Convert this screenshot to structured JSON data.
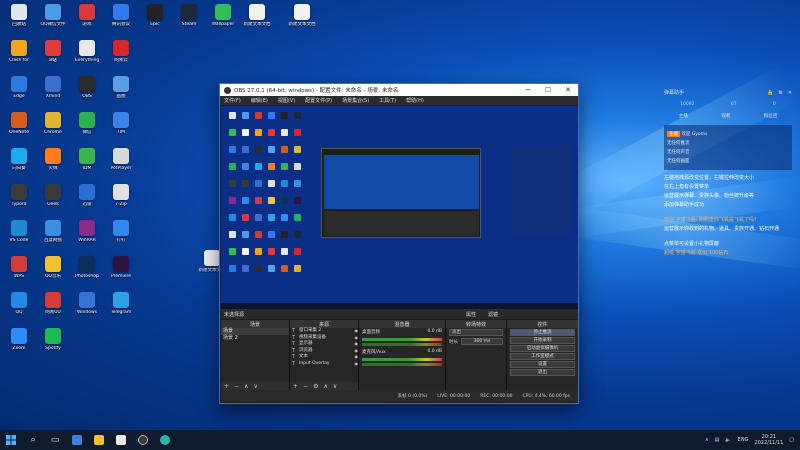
{
  "desktop": {
    "icons": [
      {
        "label": "回收站",
        "color": "#dfe7ef"
      },
      {
        "label": "QQ微信文件",
        "color": "#4a9be8"
      },
      {
        "label": "游戏",
        "color": "#d63a3a"
      },
      {
        "label": "腾讯会议",
        "color": "#2f7af0"
      },
      {
        "label": "Epic",
        "color": "#222222"
      },
      {
        "label": "Steam",
        "color": "#1b2838"
      },
      {
        "label": "Wallpaper",
        "color": "#2fbf5a"
      },
      {
        "label": "新建文本文档",
        "color": "#f2f2f2"
      },
      {
        "label": "Clash for",
        "color": "#f1a41c"
      },
      {
        "label": "B站",
        "color": "#e33b3b"
      },
      {
        "label": "Everything",
        "color": "#e9e9e9"
      },
      {
        "label": "网易云",
        "color": "#d6262a"
      },
      {
        "label": "Edge",
        "color": "#2a7ae0"
      },
      {
        "label": "Xmind",
        "color": "#3a6fcf"
      },
      {
        "label": "OBS",
        "color": "#2b2b2b"
      },
      {
        "label": "画图",
        "color": "#5a9ee3"
      },
      {
        "label": "OneNote",
        "color": "#d45c1e"
      },
      {
        "label": "Chrome",
        "color": "#e3b52e"
      },
      {
        "label": "微信",
        "color": "#2bb24c"
      },
      {
        "label": "TIM",
        "color": "#3b83e6"
      },
      {
        "label": "向日葵",
        "color": "#1eaaf0"
      },
      {
        "label": "火绒",
        "color": "#ff7c1a"
      },
      {
        "label": "IDM",
        "color": "#3cb44b"
      },
      {
        "label": "PotPlayer",
        "color": "#d9d9d9"
      },
      {
        "label": "Typora",
        "color": "#3b3b3b"
      },
      {
        "label": "Geek",
        "color": "#3a3a3a"
      },
      {
        "label": "迅雷",
        "color": "#2a6fd6"
      },
      {
        "label": "7-Zip",
        "color": "#e1e1e1"
      },
      {
        "label": "VS Code",
        "color": "#1f8ad3"
      },
      {
        "label": "百度网盘",
        "color": "#3a8ee6"
      },
      {
        "label": "WinRAR",
        "color": "#8a2c8a"
      },
      {
        "label": "钉钉",
        "color": "#2f88f0"
      },
      {
        "label": "WPS",
        "color": "#d43b3b"
      },
      {
        "label": "QQ音乐",
        "color": "#f2c12e"
      },
      {
        "label": "Photoshop",
        "color": "#0a2f5a"
      },
      {
        "label": "Premiere",
        "color": "#2a1446"
      },
      {
        "label": "QQ",
        "color": "#1e8be6"
      },
      {
        "label": "网易UU",
        "color": "#d63a3a"
      },
      {
        "label": "Windows",
        "color": "#3574d4"
      },
      {
        "label": "Telegram",
        "color": "#2aa3e6"
      },
      {
        "label": "Zoom",
        "color": "#2d8cff"
      },
      {
        "label": "Spotify",
        "color": "#1db954"
      }
    ],
    "loose_file": "新建文本文档"
  },
  "obs": {
    "title": "OBS 27.0.1 (64-bit, windows) - 配置文件: 未命名 - 场景: 未命名",
    "menu": [
      "文件(F)",
      "编辑(E)",
      "视图(V)",
      "配置文件(P)",
      "场景集合(S)",
      "工具(T)",
      "帮助(H)"
    ],
    "scene_label": "未选择源",
    "scene_tabs": [
      "属性",
      "滤镜"
    ],
    "panels": {
      "scenes_title": "场景",
      "scenes": [
        "场景",
        "场景 2"
      ],
      "sources_title": "来源",
      "sources": [
        "窗口采集 2",
        "视频采集设备",
        "显示器",
        "浏览器",
        "文本",
        "Input Overlay"
      ],
      "mixer_title": "混音器",
      "mixer": [
        {
          "name": "桌面音频",
          "level": "0.0 dB"
        },
        {
          "name": "麦克风/Aux",
          "level": "0.0 dB"
        }
      ],
      "transitions_title": "转场特效",
      "transition": "淡出",
      "duration_label": "时长",
      "duration": "300 ms",
      "controls_title": "控件",
      "controls": [
        "停止推流",
        "开始录制",
        "启动虚拟摄像机",
        "工作室模式",
        "设置",
        "退出"
      ]
    },
    "status": {
      "dropped": "丢帧 0 (0.0%)",
      "live": "LIVE: 00:00:00",
      "rec": "REC: 00:00:00",
      "cpu": "CPU: 4.4%, 60.00 fps"
    }
  },
  "sideapp": {
    "header": "弹幕助手",
    "stats": [
      "10092",
      "67",
      "0"
    ],
    "tabs": [
      "主播",
      "观看",
      "粉丝团"
    ],
    "chat_tag": "主播",
    "chat_lines": [
      "欢迎 Gyoms",
      "无任何推流",
      "无任何声音",
      "无任何画面"
    ],
    "messages": [
      {
        "text": "左键拖拽源改变位置，右键拉伸改变大小",
        "style": "white"
      },
      {
        "text": "在右上角有设置菜单",
        "style": "white"
      },
      {
        "text": "运营展示弹幕、贵族头像、粉丝牌升级等",
        "style": "white"
      },
      {
        "text": "添加弹幕助手成功",
        "style": "white"
      },
      {
        "text": "欢迎 宇宙飞船: 刚刚送你飞机是飞机了吗?",
        "style": "orange"
      },
      {
        "text": "运营展示你收到的礼物、道具、贵族开通、钻石开通",
        "style": "white"
      },
      {
        "text": "点菜单可设置小礼物屏蔽",
        "style": "white"
      },
      {
        "text": "超级 宇宙飞船 送出 100钻石",
        "style": "orange"
      }
    ]
  },
  "taskbar": {
    "tray": {
      "lang": "ENG",
      "time": "20:21",
      "date": "2022/11/11"
    }
  }
}
